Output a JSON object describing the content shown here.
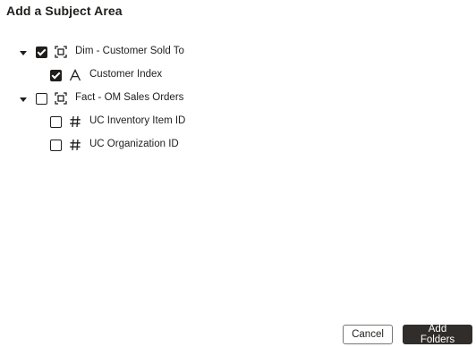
{
  "dialog": {
    "title": "Add a Subject Area"
  },
  "tree": {
    "nodes": [
      {
        "label": "Dim - Customer Sold To",
        "checked": true,
        "icon": "folder-frame-icon",
        "expanded": true
      },
      {
        "label": "Customer Index",
        "checked": true,
        "icon": "text-attribute-icon"
      },
      {
        "label": "Fact - OM Sales Orders",
        "checked": false,
        "icon": "folder-frame-icon",
        "expanded": true
      },
      {
        "label": "UC Inventory Item ID",
        "checked": false,
        "icon": "hash-icon"
      },
      {
        "label": "UC Organization ID",
        "checked": false,
        "icon": "hash-icon"
      }
    ]
  },
  "footer": {
    "cancel_label": "Cancel",
    "add_label": "Add Folders"
  },
  "colors": {
    "primary_button": "#312d2a",
    "text": "#1f1e1c"
  }
}
